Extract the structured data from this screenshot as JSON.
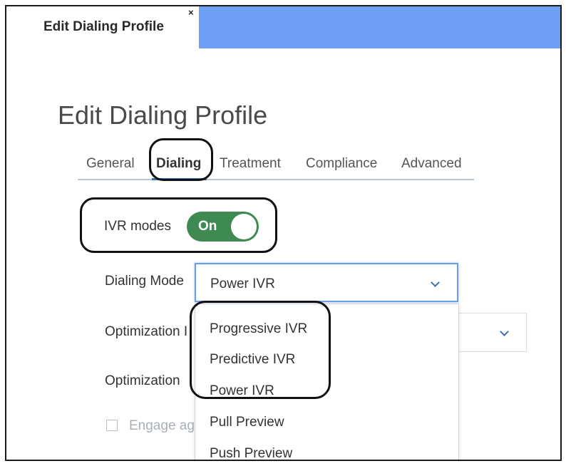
{
  "tab_bar": {
    "tab_title": "Edit Dialing Profile",
    "close_glyph": "×"
  },
  "page": {
    "title": "Edit Dialing Profile"
  },
  "subtabs": [
    {
      "label": "General"
    },
    {
      "label": "Dialing",
      "active": true
    },
    {
      "label": "Treatment"
    },
    {
      "label": "Compliance"
    },
    {
      "label": "Advanced"
    }
  ],
  "ivr_modes": {
    "label": "IVR modes",
    "toggle_text": "On",
    "enabled": true
  },
  "dialing_mode": {
    "label": "Dialing Mode",
    "selected": "Power IVR",
    "options": [
      "Progressive IVR",
      "Predictive IVR",
      "Power IVR",
      "Pull Preview",
      "Push Preview"
    ]
  },
  "optimization_1": {
    "label": "Optimization I"
  },
  "optimization_2": {
    "label": "Optimization"
  },
  "engage": {
    "label": "Engage ag"
  },
  "colors": {
    "tab_bar_blue": "#6fa0f5",
    "toggle_green": "#3f8a53",
    "accent_blue": "#3a6fb0",
    "annotation_ring": "#111111"
  },
  "icons": {
    "dropdown": "chevron-down-icon",
    "close": "close-icon"
  }
}
